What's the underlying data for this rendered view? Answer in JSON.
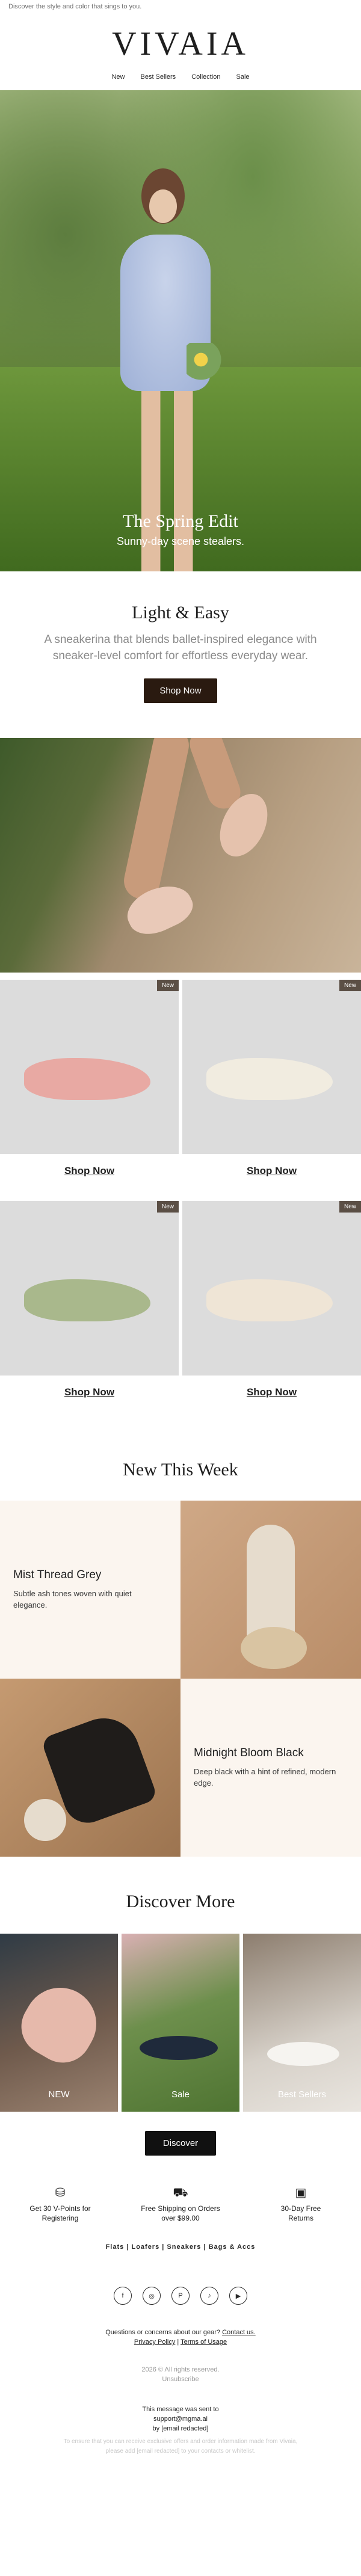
{
  "preheader": "Discover the style and color that sings to you.",
  "brand": "VIVAIA",
  "nav": [
    "New",
    "Best Sellers",
    "Collection",
    "Sale"
  ],
  "hero": {
    "title": "The Spring Edit",
    "subtitle": "Sunny-day scene stealers."
  },
  "intro": {
    "title": "Light & Easy",
    "body": "A sneakerina that blends ballet-inspired elegance with sneaker-level comfort for effortless everyday wear.",
    "button": "Shop Now"
  },
  "products": [
    {
      "badge": "New",
      "link": "Shop Now",
      "color": "#e8a9a3"
    },
    {
      "badge": "New",
      "link": "Shop Now",
      "color": "#f1ece0"
    },
    {
      "badge": "New",
      "link": "Shop Now",
      "color": "#a9b88c"
    },
    {
      "badge": "New",
      "link": "Shop Now",
      "color": "#efe5d6"
    }
  ],
  "new_this_week": {
    "title": "New This Week",
    "items": [
      {
        "name": "Mist Thread Grey",
        "desc": "Subtle ash tones woven with quiet elegance."
      },
      {
        "name": "Midnight Bloom Black",
        "desc": "Deep black with a hint of refined, modern edge."
      }
    ]
  },
  "discover": {
    "title": "Discover More",
    "tiles": [
      {
        "label": "NEW"
      },
      {
        "label": "Sale"
      },
      {
        "label": "Best Sellers"
      }
    ],
    "button": "Discover"
  },
  "benefits": [
    {
      "icon": "coins-icon",
      "line1": "Get 30 V-Points for",
      "line2": "Registering"
    },
    {
      "icon": "truck-icon",
      "line1": "Free Shipping on Orders",
      "line2": "over $99.00"
    },
    {
      "icon": "box-icon",
      "line1": "30-Day Free",
      "line2": "Returns"
    }
  ],
  "categories": [
    "Flats",
    "Loafers",
    "Sneakers",
    "Bags & Accs"
  ],
  "social": [
    {
      "icon": "facebook-icon",
      "glyph": "f"
    },
    {
      "icon": "instagram-icon",
      "glyph": "◎"
    },
    {
      "icon": "pinterest-icon",
      "glyph": "P"
    },
    {
      "icon": "tiktok-icon",
      "glyph": "♪"
    },
    {
      "icon": "youtube-icon",
      "glyph": "▶"
    }
  ],
  "footer": {
    "question": "Questions or concerns about our gear?",
    "contact": "Contact us.",
    "privacy": "Privacy Policy",
    "sep": " | ",
    "terms": "Terms of Usage",
    "copyright": "2026 © All rights reserved.",
    "unsubscribe": "Unsubscribe",
    "sent_to_line": "This message was sent to",
    "sent_to_email": "support@mgma.ai",
    "by_line": "by [email redacted]",
    "disclaimer_1": "To ensure that you can receive exclusive offers and order information made from Vivaia,",
    "disclaimer_2": "please add [email redacted] to your contacts or whitelist."
  }
}
